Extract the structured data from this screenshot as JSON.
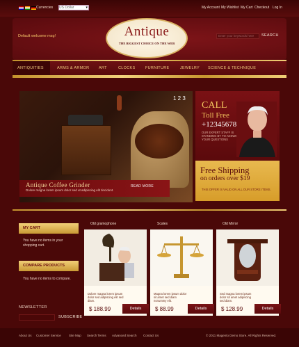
{
  "topbar": {
    "currency_label": "Currencies",
    "currency_value": "US Dollar",
    "links": [
      "My Account",
      "My Wishlist",
      "My Cart",
      "Checkout",
      "Log In"
    ]
  },
  "header": {
    "welcome": "Default welcome msg!",
    "logo_title": "Antique",
    "logo_tagline": "THE BIGGEST CHOICE ON THE WEB",
    "search_placeholder": "Enter your keywords here",
    "search_button": "SEARCH"
  },
  "nav": {
    "items": [
      "ANTIQUITIES",
      "ARMS & ARMOR",
      "ART",
      "CLOCKS",
      "FURNITURE",
      "JEWELRY",
      "SCIENCE & TECHNIQUE"
    ]
  },
  "slider": {
    "pages": "1 2 3",
    "caption_title": "Antique Coffee Grinder",
    "caption_desc": "Dolore magna lorem ipsum dolor sed ut adipiscing elit tincidunt.",
    "read_more": "READ MORE"
  },
  "call_box": {
    "title": "CALL",
    "subtitle": "Toll Free",
    "phone": "+123456789",
    "desc": "OUR EXPERT STAFF IS STANDING BY TO ANSWER YOUR QUESTIONS"
  },
  "shipping": {
    "title": "Free Shipping",
    "subtitle": "on orders over $19",
    "desc": "THIS OFFER IS VALID ON ALL OUR STORE ITEMS."
  },
  "sidebar": {
    "cart_title": "MY CART",
    "cart_text": "You have no items in your shopping cart.",
    "compare_title": "COMPARE PRODUCTS",
    "compare_text": "You have no items to compare.",
    "newsletter_title": "NEWSLETTER",
    "subscribe_button": "SUBSCRIBE"
  },
  "products": [
    {
      "name": "Old gramophone",
      "desc": "Dolore magna lorem ipsum dolor sed adipiscing elit sed diam.",
      "price": "$ 188.99",
      "button": "Details"
    },
    {
      "name": "Scales",
      "desc": "Magna lorem ipsum dolor sit amet sed diam nonummy elit.",
      "price": "$ 88.99",
      "button": "Details"
    },
    {
      "name": "Old Mirror",
      "desc": "Sed magna lorem ipsum dolor sit amet adipiscing sed diam.",
      "price": "$ 128.99",
      "button": "Details"
    }
  ],
  "footer": {
    "links": [
      "About Us",
      "Customer Service",
      "Site Map",
      "Search Terms",
      "Advanced Search",
      "Contact Us"
    ],
    "copyright": "© 2011 Magento Demo Store. All Rights Reserved."
  }
}
